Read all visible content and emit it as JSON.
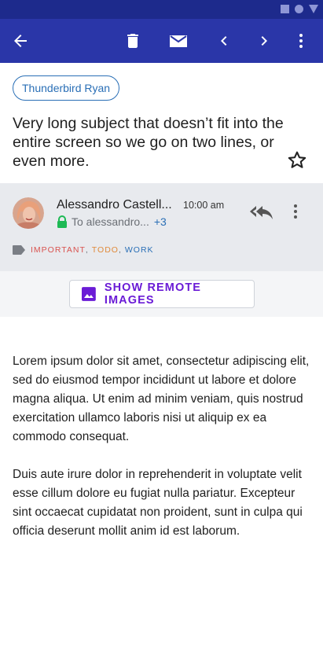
{
  "app_bar": {
    "actions": [
      "back-icon",
      "delete-icon",
      "mark-unread-icon",
      "previous-icon",
      "next-icon",
      "more-vert-icon"
    ],
    "background": "#2a36a8"
  },
  "folder_chip": {
    "label": "Thunderbird Ryan"
  },
  "message": {
    "subject": "Very long subject that doesn’t fit into the entire screen so we go on two lines, or even more.",
    "sender": "Alessandro Castell...",
    "time": "10:00 am",
    "recipient": "To alessandro...",
    "recipient_more": "+3",
    "labels": [
      {
        "text": "IMPORTANT",
        "color": "#d9534f"
      },
      {
        "text": "TODO",
        "color": "#e08a3a"
      },
      {
        "text": "WORK",
        "color": "#2a6fb6"
      }
    ],
    "remote_images_button": "SHOW REMOTE IMAGES",
    "body": [
      "Lorem ipsum dolor sit amet, consectetur adipiscing elit, sed do eiusmod tempor incididunt ut labore et dolore magna aliqua. Ut enim ad minim veniam, quis nostrud exercitation ullamco laboris nisi ut aliquip ex ea commodo consequat.",
      "Duis aute irure dolor in reprehenderit in voluptate velit esse cillum dolore eu fugiat nulla pariatur. Excepteur sint occaecat cupidatat non proident, sunt in culpa qui officia deserunt mollit anim id est laborum."
    ]
  }
}
